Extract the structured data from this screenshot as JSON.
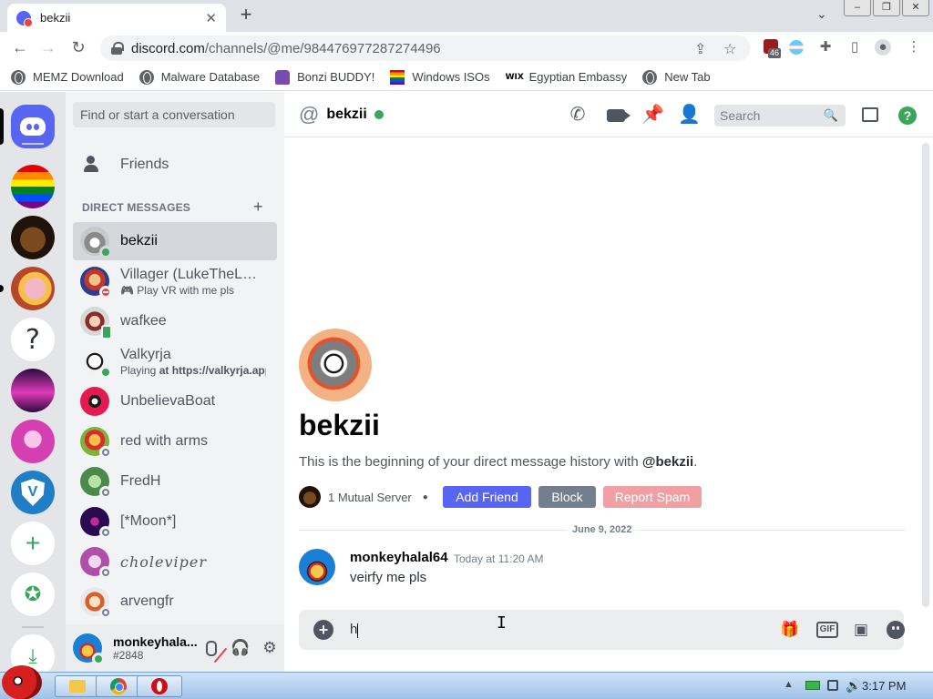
{
  "browser": {
    "tab_title": "bekzii",
    "url_domain": "discord.com",
    "url_path": "/channels/@me/984476977287274496",
    "extension_badge": "46",
    "bookmarks": [
      {
        "label": "MEMZ Download",
        "icon": "globe-icon"
      },
      {
        "label": "Malware Database",
        "icon": "globe-icon"
      },
      {
        "label": "Bonzi BUDDY!",
        "icon": "bonzi-icon"
      },
      {
        "label": "Windows ISOs",
        "icon": "rainbow-flag-icon"
      },
      {
        "label": "Egyptian Embassy",
        "icon": "wix-icon",
        "icon_text": "WIX"
      },
      {
        "label": "New Tab",
        "icon": "globe-icon"
      }
    ]
  },
  "sidebar": {
    "search_placeholder": "Find or start a conversation",
    "friends_label": "Friends",
    "dm_header": "DIRECT MESSAGES",
    "dms": [
      {
        "name": "bekzii",
        "status": "online",
        "active": true
      },
      {
        "name": "Villager (LukeTheLPS...",
        "status": "dnd",
        "sub": "Play VR with me pls"
      },
      {
        "name": "wafkee",
        "status": "mobile"
      },
      {
        "name": "Valkyrja",
        "status": "online",
        "sub_prefix": "Playing ",
        "sub_bold": "at https://valkyrja.app"
      },
      {
        "name": "UnbelievaBoat",
        "status": "none"
      },
      {
        "name": "red with arms",
        "status": "offline"
      },
      {
        "name": "FredH",
        "status": "offline"
      },
      {
        "name": "[*Moon*]",
        "status": "offline"
      },
      {
        "name": "choleviper",
        "status": "offline"
      },
      {
        "name": "arvengfr",
        "status": "offline"
      }
    ],
    "user": {
      "name": "monkeyhala...",
      "tag": "#2848"
    }
  },
  "chat": {
    "header_name": "bekzii",
    "search_placeholder": "Search",
    "intro_name": "bekzii",
    "intro_desc_prefix": "This is the beginning of your direct message history with ",
    "intro_desc_handle": "@bekzii",
    "intro_desc_suffix": ".",
    "mutual_servers": "1 Mutual Server",
    "add_friend": "Add Friend",
    "block": "Block",
    "report_spam": "Report Spam",
    "date_divider": "June 9, 2022",
    "messages": [
      {
        "author": "monkeyhalal64",
        "time": "Today at 11:20 AM",
        "text": "veirfy me pls"
      }
    ],
    "composer_value": "h",
    "composer_icons": {
      "gif_label": "GIF"
    }
  },
  "colors": {
    "blurple": "#5865f2",
    "online": "#3ba55c",
    "dnd": "#ed4245",
    "offline": "#747f8d"
  },
  "taskbar": {
    "clock": "3:17 PM"
  }
}
